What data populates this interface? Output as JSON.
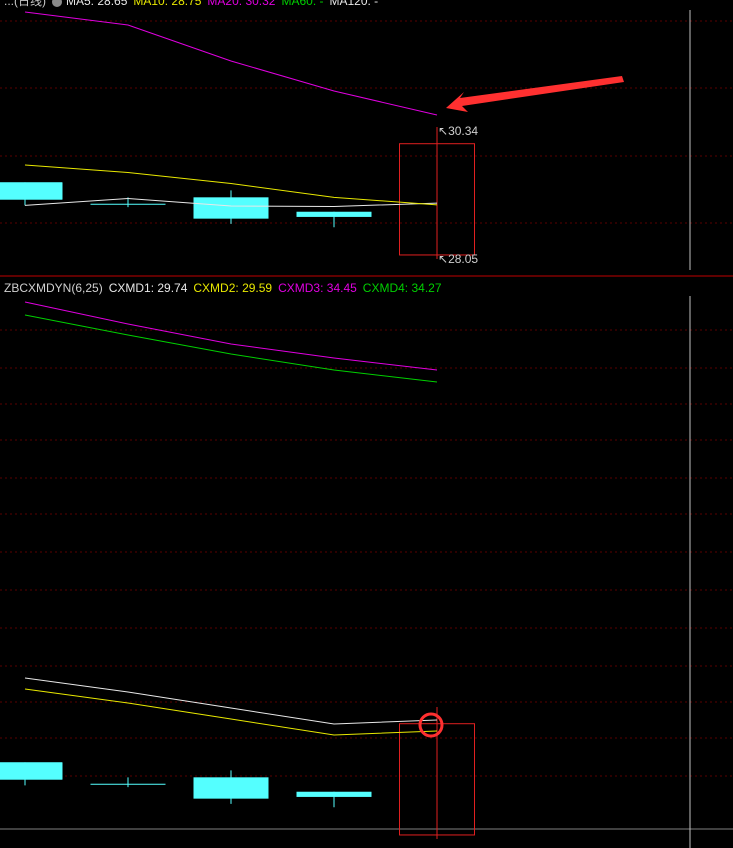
{
  "colors": {
    "background": "#000000",
    "grid": "#5a0000",
    "separator": "#c00000",
    "cursor": "#bfbfbf",
    "bull": "#e02020",
    "bear": "#54ffff",
    "white_line": "#e8e8e8",
    "yellow_line": "#e8e800",
    "magenta_line": "#e000e0",
    "green_line": "#00d000",
    "annotation": "#ff3030"
  },
  "top_panel": {
    "legend": {
      "title": "...(日线)",
      "icon": "circle-dot-icon",
      "items": [
        {
          "label": "MA5: 28.65",
          "color": "#e8e8e8"
        },
        {
          "label": "MA10: 28.75",
          "color": "#e8e800"
        },
        {
          "label": "MA20: 30.32",
          "color": "#e000e0"
        },
        {
          "label": "MA60: -",
          "color": "#00d000"
        },
        {
          "label": "MA120: -",
          "color": "#e8e8e8"
        }
      ]
    },
    "high_label": "30.34",
    "low_label": "28.05",
    "annotation": "red-arrow pointing to MA20 end"
  },
  "bottom_panel": {
    "legend": {
      "indicator": "ZBCXMDYN(6,25)",
      "items": [
        {
          "label": "CXMD1: 29.74",
          "color": "#e8e8e8"
        },
        {
          "label": "CXMD2: 29.59",
          "color": "#e8e800"
        },
        {
          "label": "CXMD3: 34.45",
          "color": "#e000e0"
        },
        {
          "label": "CXMD4: 34.27",
          "color": "#00d000"
        }
      ]
    },
    "annotation": "red circle on CXMD1 last point"
  },
  "chart_data": {
    "type": "candlestick",
    "candles": [
      {
        "index": 1,
        "open": 29.38,
        "close": 29.08,
        "high": 29.38,
        "low": 28.98
      },
      {
        "index": 2,
        "open": 29.0,
        "close": 29.0,
        "high": 29.12,
        "low": 28.95
      },
      {
        "index": 3,
        "open": 29.12,
        "close": 28.75,
        "high": 29.24,
        "low": 28.66
      },
      {
        "index": 4,
        "open": 28.87,
        "close": 28.78,
        "high": 28.87,
        "low": 28.6
      },
      {
        "index": 5,
        "open": 28.12,
        "close": 30.05,
        "high": 30.34,
        "low": 28.05
      }
    ],
    "series": [
      {
        "name": "MA5",
        "values": [
          29.05,
          29.1,
          28.97,
          28.96,
          29.02
        ]
      },
      {
        "name": "MA10",
        "values": [
          29.68,
          29.55,
          29.36,
          29.12,
          28.99
        ]
      },
      {
        "name": "MA20",
        "values": [
          34.5,
          34.3,
          33.05,
          31.8,
          31.0
        ]
      },
      {
        "name": "CXMD1",
        "values": [
          null,
          null,
          null,
          29.62,
          29.74
        ]
      },
      {
        "name": "CXMD2",
        "values": [
          null,
          null,
          null,
          29.46,
          29.59
        ]
      },
      {
        "name": "CXMD3",
        "values": [
          null,
          null,
          null,
          34.62,
          34.45
        ]
      },
      {
        "name": "CXMD4",
        "values": [
          null,
          null,
          null,
          34.45,
          34.27
        ]
      }
    ]
  }
}
